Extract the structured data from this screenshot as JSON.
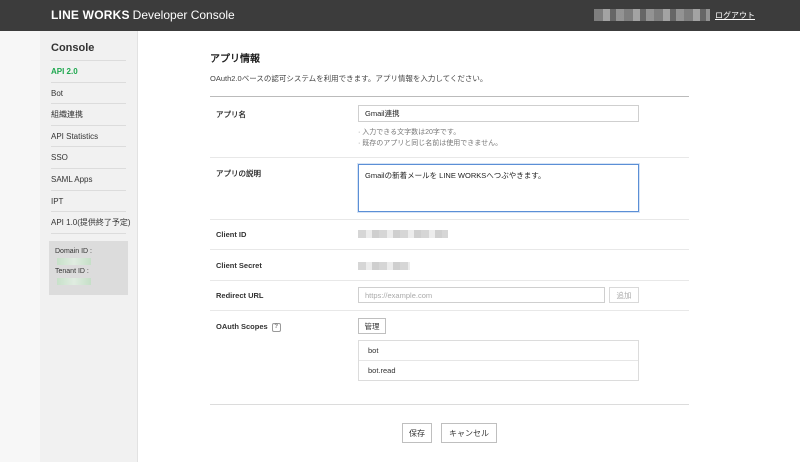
{
  "header": {
    "brand_bold": "LINE WORKS",
    "brand_rest": "Developer Console",
    "logout_label": "ログアウト"
  },
  "sidebar": {
    "title": "Console",
    "items": [
      {
        "label": "API 2.0",
        "active": true
      },
      {
        "label": "Bot"
      },
      {
        "label": "組織連携"
      },
      {
        "label": "API Statistics"
      },
      {
        "label": "SSO"
      },
      {
        "label": "SAML Apps"
      },
      {
        "label": "IPT"
      },
      {
        "label": "API 1.0(提供終了予定)"
      }
    ],
    "domain_id_label": "Domain ID :",
    "tenant_id_label": "Tenant ID :"
  },
  "main": {
    "title": "アプリ情報",
    "description": "OAuth2.0ベースの認可システムを利用できます。アプリ情報を入力してください。",
    "app_name": {
      "label": "アプリ名",
      "value": "Gmail連携",
      "hint1": "· 入力できる文字数は20字です。",
      "hint2": "· 既存のアプリと同じ名前は使用できません。"
    },
    "app_description": {
      "label": "アプリの説明",
      "value": "Gmailの新着メールを LINE WORKSへつぶやきます。"
    },
    "client_id": {
      "label": "Client ID"
    },
    "client_secret": {
      "label": "Client Secret"
    },
    "redirect_url": {
      "label": "Redirect URL",
      "placeholder": "https://example.com",
      "add_label": "追加"
    },
    "oauth_scopes": {
      "label": "OAuth Scopes",
      "help": "?",
      "manage_label": "管理",
      "scopes": [
        "bot",
        "bot.read"
      ]
    },
    "save_label": "保存",
    "cancel_label": "キャンセル"
  }
}
